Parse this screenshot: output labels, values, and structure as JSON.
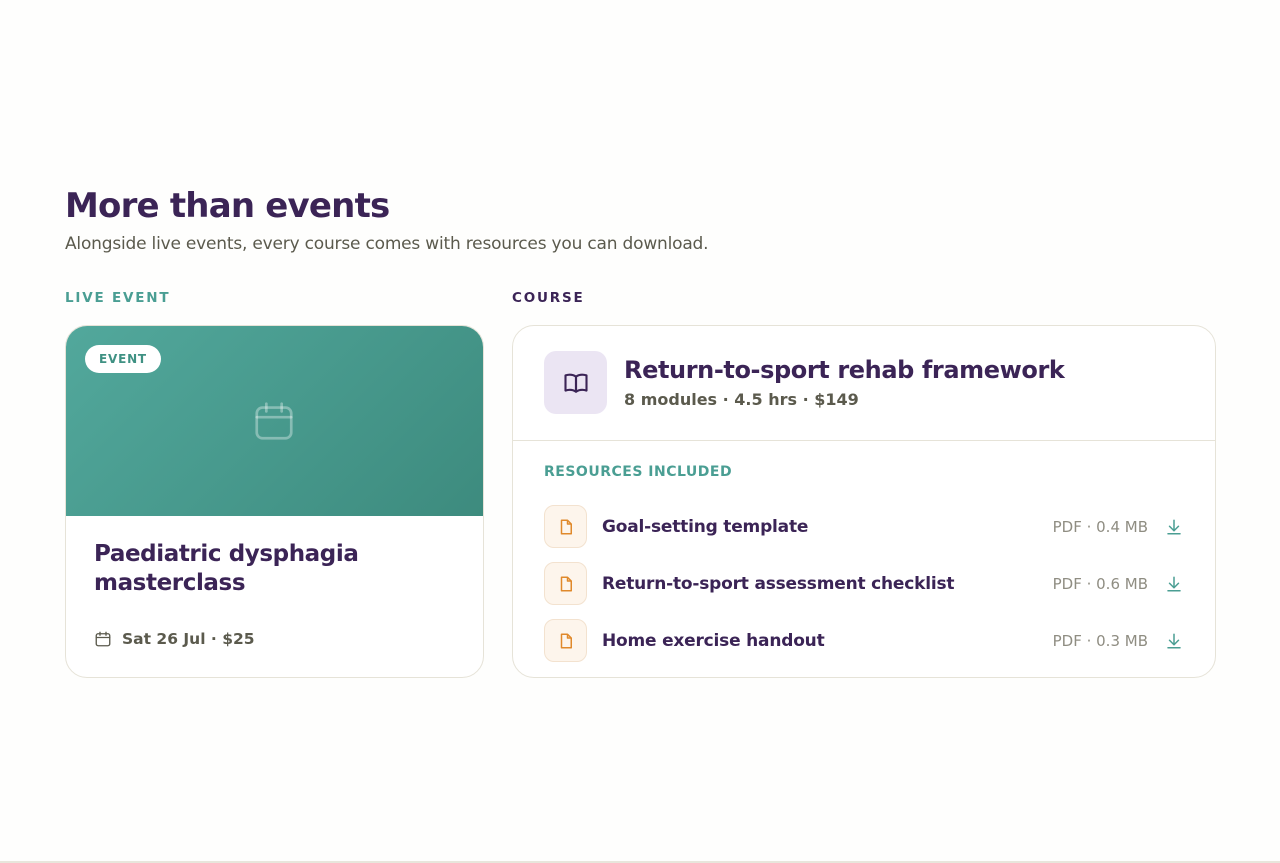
{
  "section": {
    "heading": "More than events",
    "subheading": "Alongside live events, every course comes with resources you can download."
  },
  "live_event": {
    "column_label": "LIVE EVENT",
    "badge": "EVENT",
    "hero_icon": "calendar-icon",
    "title": "Paediatric dysphagia masterclass",
    "meta": "Sat 26 Jul · $25",
    "meta_icon": "calendar-icon"
  },
  "course": {
    "column_label": "COURSE",
    "icon": "book-open-icon",
    "title": "Return-to-sport rehab framework",
    "meta": "8 modules · 4.5 hrs · $149",
    "resources_label": "RESOURCES INCLUDED",
    "resources": [
      {
        "name": "Goal-setting template",
        "size": "PDF · 0.4 MB",
        "icon": "file-icon"
      },
      {
        "name": "Return-to-sport assessment checklist",
        "size": "PDF · 0.6 MB",
        "icon": "file-icon"
      },
      {
        "name": "Home exercise handout",
        "size": "PDF · 0.3 MB",
        "icon": "file-icon"
      }
    ]
  },
  "colors": {
    "primary": "#3b2456",
    "accent": "#4a9e93",
    "muted": "#5b5a4d",
    "file_accent": "#e0892b"
  }
}
